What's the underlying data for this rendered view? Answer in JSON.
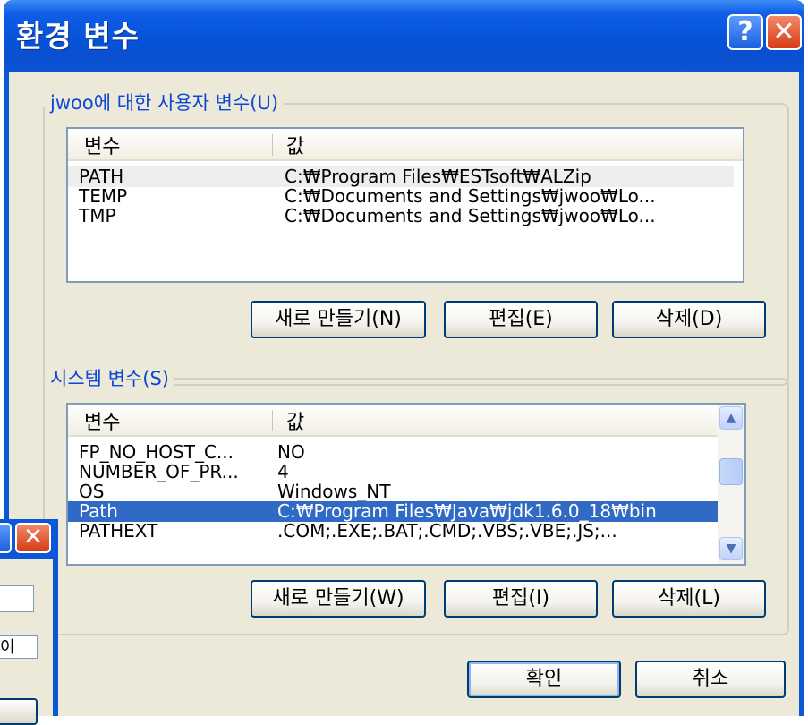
{
  "window": {
    "title": "환경 변수",
    "help_glyph": "?",
    "close_glyph": "✕"
  },
  "user_vars": {
    "legend": "jwoo에 대한 사용자 변수(U)",
    "columns": [
      "변수",
      "값"
    ],
    "rows": [
      {
        "name": "PATH",
        "value": "C:₩Program Files₩ESTsoft₩ALZip"
      },
      {
        "name": "TEMP",
        "value": "C:₩Documents and Settings₩jwoo₩Lo..."
      },
      {
        "name": "TMP",
        "value": "C:₩Documents and Settings₩jwoo₩Lo..."
      }
    ],
    "buttons": {
      "new": "새로 만들기(N)",
      "edit": "편집(E)",
      "delete": "삭제(D)"
    }
  },
  "system_vars": {
    "legend": "시스템 변수(S)",
    "columns": [
      "변수",
      "값"
    ],
    "rows": [
      {
        "name": "FP_NO_HOST_C...",
        "value": "NO"
      },
      {
        "name": "NUMBER_OF_PR...",
        "value": "4"
      },
      {
        "name": "OS",
        "value": "Windows_NT"
      },
      {
        "name": "Path",
        "value": "C:₩Program Files₩Java₩jdk1.6.0_18₩bin"
      },
      {
        "name": "PATHEXT",
        "value": ".COM;.EXE;.BAT;.CMD;.VBS;.VBE;.JS;..."
      }
    ],
    "buttons": {
      "new": "새로 만들기(W)",
      "edit": "편집(I)",
      "delete": "삭제(L)"
    }
  },
  "footer": {
    "ok": "확인",
    "cancel": "취소"
  },
  "background_dialog": {
    "close_glyph": "✕",
    "partial_text": "이"
  }
}
